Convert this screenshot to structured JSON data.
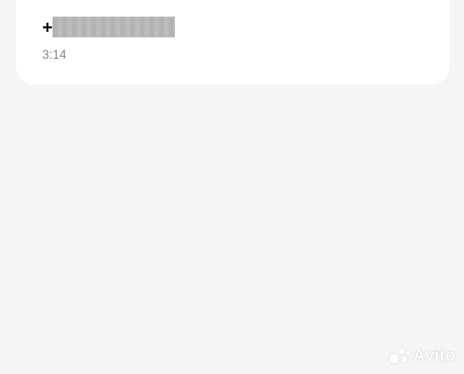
{
  "call": {
    "number_prefix": "+",
    "duration": "3:14"
  },
  "watermark": {
    "text": "Avito"
  }
}
